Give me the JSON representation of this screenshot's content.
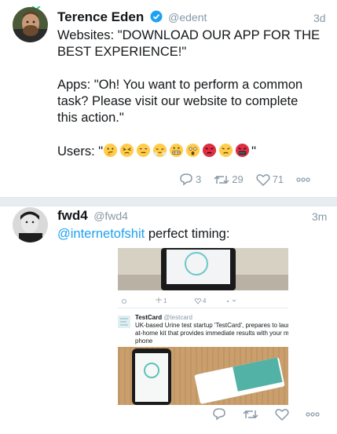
{
  "tweets": [
    {
      "name": "Terence Eden",
      "handle": "@edent",
      "time": "3d",
      "verified": true,
      "lines": [
        "Websites: \"DOWNLOAD OUR APP FOR THE",
        "BEST EXPERIENCE!\"",
        "",
        "Apps: \"Oh! You want to perform a common",
        "task? Please visit our website to complete",
        "this action.\"",
        ""
      ],
      "users_prefix": "Users: \"",
      "users_suffix": "\"",
      "emojis": [
        "thinking-face",
        "persevering-face",
        "expressionless-face",
        "steam-face",
        "grimacing-face",
        "astonished-face",
        "pouting-face",
        "angry-face",
        "cursing-face"
      ],
      "actions": {
        "replies": "3",
        "retweets": "29",
        "likes": "71"
      }
    },
    {
      "name": "fwd4",
      "handle": "@fwd4",
      "time": "3m",
      "mention": "@internetofshit",
      "text": " perfect timing:",
      "embed": {
        "author": "TestCard",
        "author_handle": "@testcard",
        "text_lines": [
          "UK-based Urine test startup 'TestCard', prepares to launch its",
          "at-home kit that provides immediate results with your mobile",
          "phone"
        ],
        "mini_retweets": "1",
        "mini_likes": "4"
      },
      "actions": {
        "replies": "",
        "retweets": "",
        "likes": ""
      }
    }
  ],
  "colors": {
    "accent": "#1da1f2",
    "muted": "#8899a6",
    "divider": "#e6ecf0"
  }
}
